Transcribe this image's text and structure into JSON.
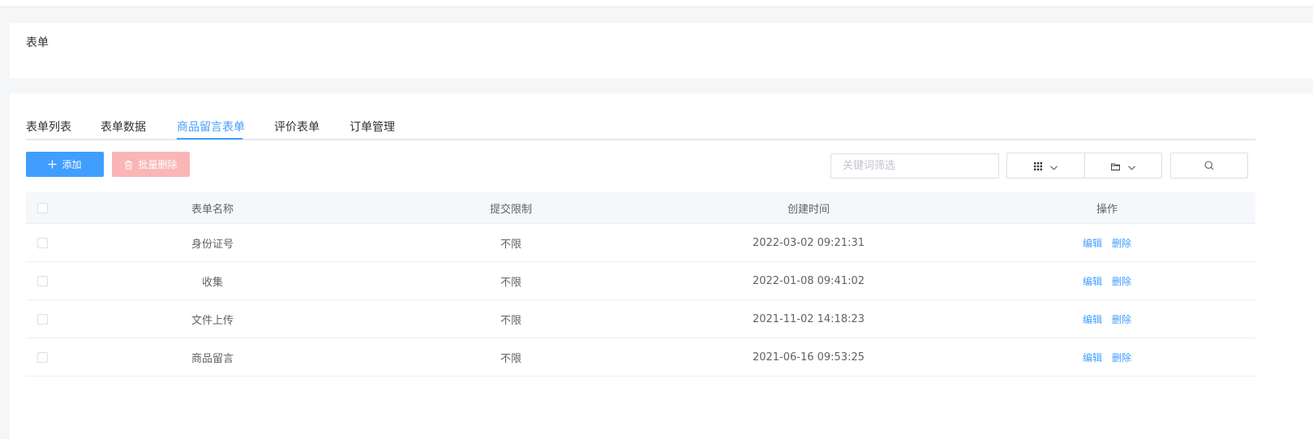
{
  "page": {
    "title": "表单"
  },
  "tabs": [
    {
      "label": "表单列表"
    },
    {
      "label": "表单数据"
    },
    {
      "label": "商品留言表单",
      "active": true
    },
    {
      "label": "评价表单"
    },
    {
      "label": "订单管理"
    }
  ],
  "toolbar": {
    "add_label": "添加",
    "batch_delete_label": "批量删除",
    "search_placeholder": "关键词筛选",
    "icons": [
      "plus-icon",
      "trash-icon",
      "grid-icon",
      "chevron-down-icon",
      "folder-icon",
      "search-icon"
    ]
  },
  "table": {
    "headers": {
      "name": "表单名称",
      "limit": "提交限制",
      "time": "创建时间",
      "ops": "操作"
    },
    "rows": [
      {
        "name": "身份证号",
        "limit": "不限",
        "time": "2022-03-02 09:21:31",
        "edit": "编辑",
        "delete": "删除"
      },
      {
        "name": "收集",
        "limit": "不限",
        "time": "2022-01-08 09:41:02",
        "edit": "编辑",
        "delete": "删除"
      },
      {
        "name": "文件上传",
        "limit": "不限",
        "time": "2021-11-02 14:18:23",
        "edit": "编辑",
        "delete": "删除"
      },
      {
        "name": "商品留言",
        "limit": "不限",
        "time": "2021-06-16 09:53:25",
        "edit": "编辑",
        "delete": "删除"
      }
    ]
  },
  "colors": {
    "primary": "#409eff",
    "danger_disabled": "#fab6b6",
    "text": "#606266"
  }
}
